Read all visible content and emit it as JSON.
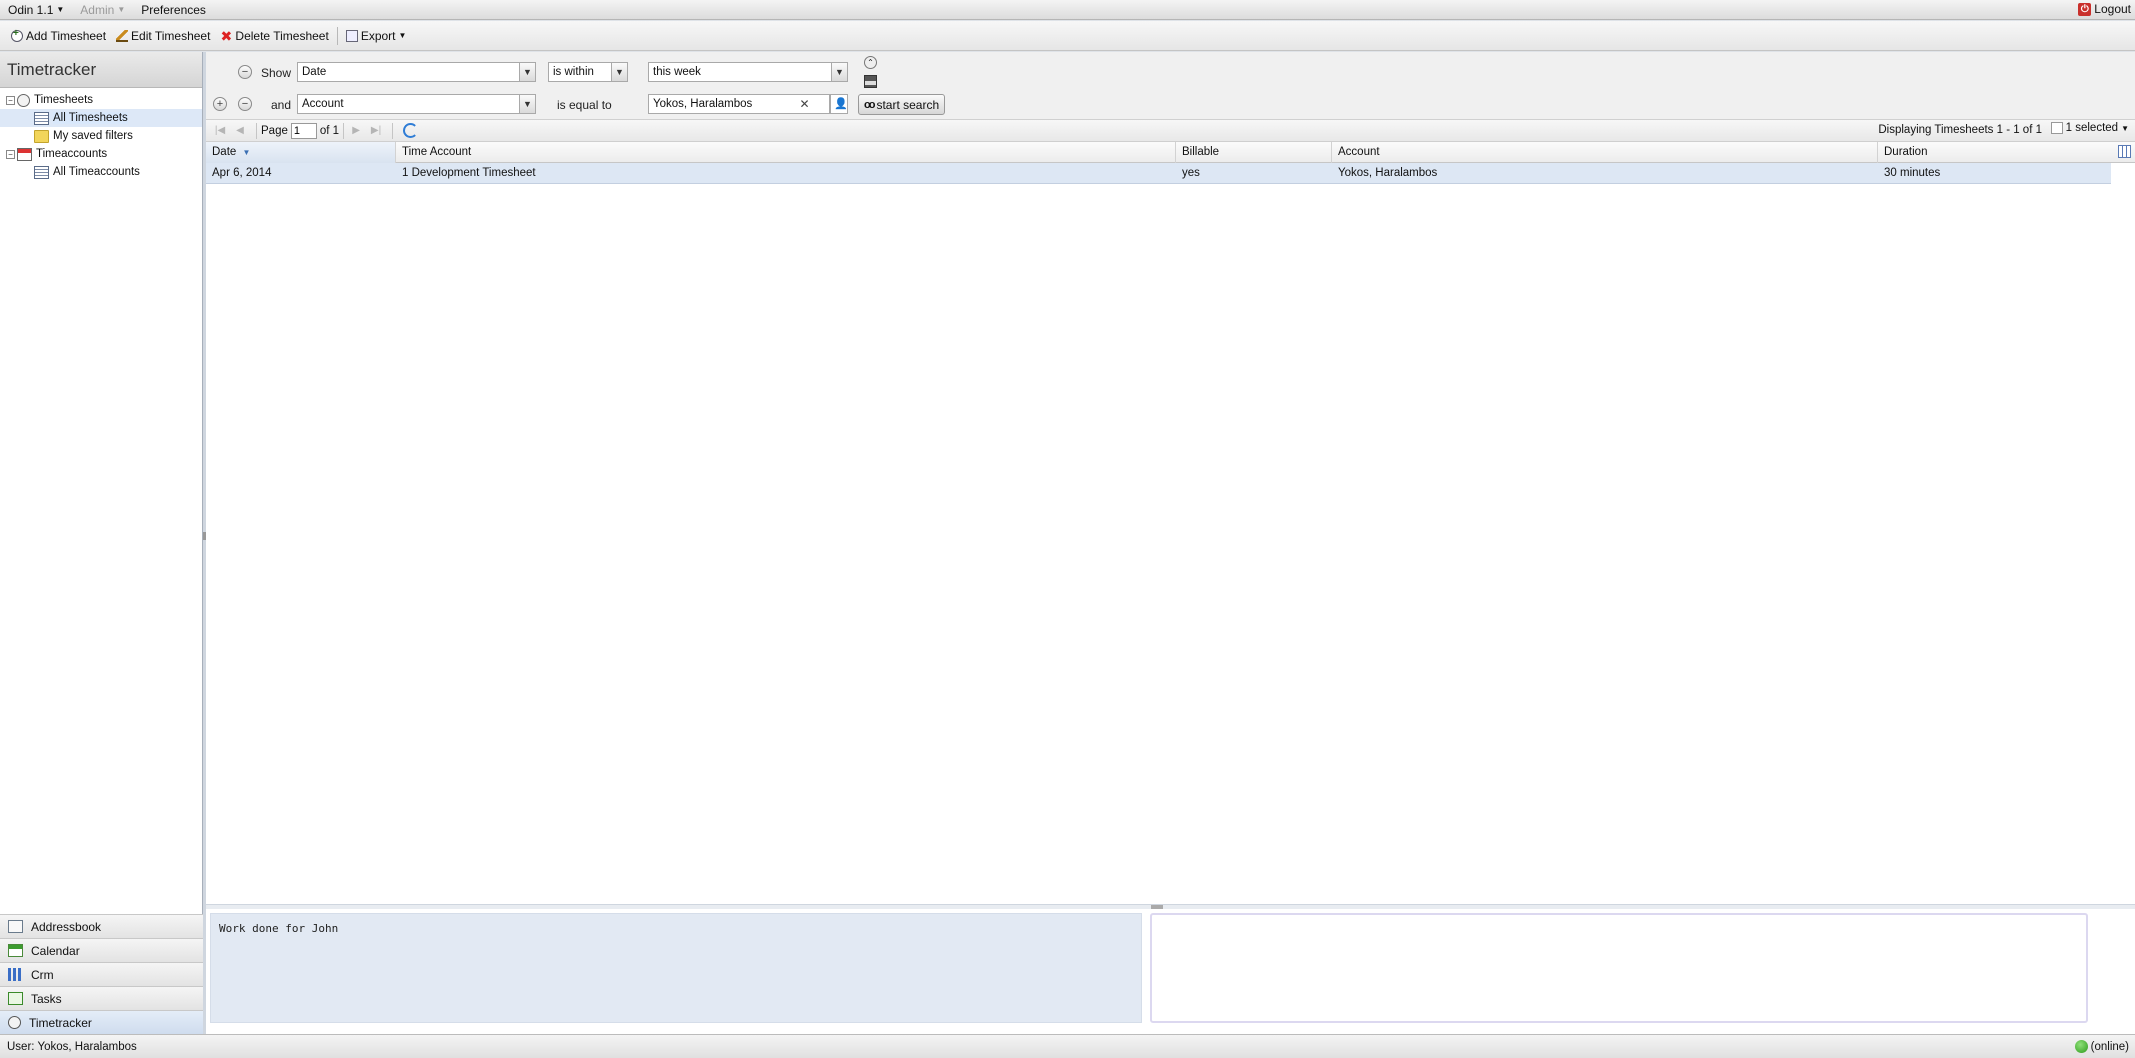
{
  "menubar": {
    "app_menu": "Odin 1.1",
    "admin": "Admin",
    "preferences": "Preferences",
    "logout": "Logout"
  },
  "toolbar": {
    "add": "Add Timesheet",
    "edit": "Edit Timesheet",
    "delete": "Delete Timesheet",
    "export": "Export"
  },
  "sidebar": {
    "title": "Timetracker",
    "tree": {
      "timesheets": "Timesheets",
      "all_timesheets": "All Timesheets",
      "saved_filters": "My saved filters",
      "timeaccounts": "Timeaccounts",
      "all_timeaccounts": "All Timeaccounts"
    },
    "modules": [
      "Addressbook",
      "Calendar",
      "Crm",
      "Tasks",
      "Timetracker"
    ]
  },
  "filter": {
    "row1": {
      "label": "Show",
      "field": "Date",
      "operator": "is within",
      "value": "this week"
    },
    "row2": {
      "label": "and",
      "field": "Account",
      "operator": "is equal to",
      "value": "Yokos, Haralambos"
    },
    "search_button": "start search"
  },
  "paging": {
    "page_label": "Page",
    "page_value": "1",
    "of_label": "of 1",
    "display_msg": "Displaying Timesheets 1 - 1 of 1",
    "selected": "1 selected"
  },
  "grid": {
    "columns": [
      "Date",
      "Time Account",
      "Billable",
      "Account",
      "Duration"
    ],
    "rows": [
      [
        "Apr 6, 2014",
        "1 Development Timesheet",
        "yes",
        "Yokos, Haralambos",
        "30 minutes"
      ]
    ]
  },
  "details": {
    "description": "Work done for John"
  },
  "status": {
    "user": "User: Yokos, Haralambos",
    "online": "(online)"
  }
}
